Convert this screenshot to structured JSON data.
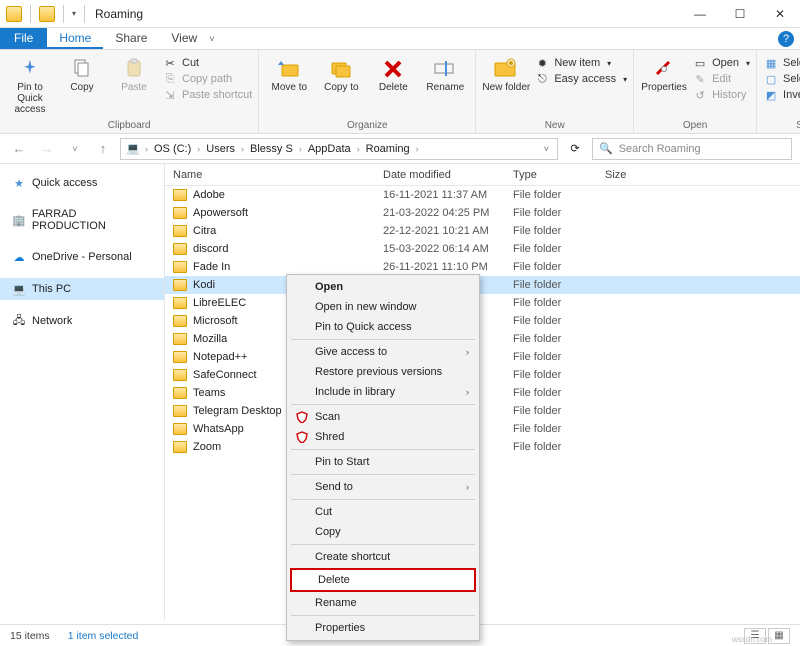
{
  "titlebar": {
    "title": "Roaming"
  },
  "tabs": {
    "file": "File",
    "home": "Home",
    "share": "Share",
    "view": "View"
  },
  "ribbon": {
    "clipboard": {
      "label": "Clipboard",
      "pin": "Pin to Quick access",
      "copy": "Copy",
      "paste": "Paste",
      "cut": "Cut",
      "copypath": "Copy path",
      "pasteshortcut": "Paste shortcut"
    },
    "organize": {
      "label": "Organize",
      "moveto": "Move to",
      "copyto": "Copy to",
      "delete": "Delete",
      "rename": "Rename"
    },
    "new": {
      "label": "New",
      "newfolder": "New folder",
      "newitem": "New item",
      "easyaccess": "Easy access"
    },
    "open": {
      "label": "Open",
      "properties": "Properties",
      "open": "Open",
      "edit": "Edit",
      "history": "History"
    },
    "select": {
      "label": "Select",
      "selectall": "Select all",
      "selectnone": "Select none",
      "invert": "Invert selection"
    }
  },
  "breadcrumb": [
    "OS (C:)",
    "Users",
    "Blessy S",
    "AppData",
    "Roaming"
  ],
  "search": {
    "placeholder": "Search Roaming"
  },
  "sidebar": {
    "quickaccess": "Quick access",
    "farrad": "FARRAD PRODUCTION",
    "onedrive": "OneDrive - Personal",
    "thispc": "This PC",
    "network": "Network"
  },
  "columns": {
    "name": "Name",
    "date": "Date modified",
    "type": "Type",
    "size": "Size"
  },
  "folders": [
    {
      "name": "Adobe",
      "date": "16-11-2021 11:37 AM",
      "type": "File folder"
    },
    {
      "name": "Apowersoft",
      "date": "21-03-2022 04:25 PM",
      "type": "File folder"
    },
    {
      "name": "Citra",
      "date": "22-12-2021 10:21 AM",
      "type": "File folder"
    },
    {
      "name": "discord",
      "date": "15-03-2022 06:14 AM",
      "type": "File folder"
    },
    {
      "name": "Fade In",
      "date": "26-11-2021 11:10 PM",
      "type": "File folder"
    },
    {
      "name": "Kodi",
      "date": "",
      "type": "File folder",
      "selected": true
    },
    {
      "name": "LibreELEC",
      "date": "",
      "type": "File folder"
    },
    {
      "name": "Microsoft",
      "date": "",
      "type": "File folder"
    },
    {
      "name": "Mozilla",
      "date": "",
      "type": "File folder"
    },
    {
      "name": "Notepad++",
      "date": "",
      "type": "File folder"
    },
    {
      "name": "SafeConnect",
      "date": "",
      "type": "File folder"
    },
    {
      "name": "Teams",
      "date": "",
      "type": "File folder"
    },
    {
      "name": "Telegram Desktop",
      "date": "",
      "type": "File folder"
    },
    {
      "name": "WhatsApp",
      "date": "",
      "type": "File folder"
    },
    {
      "name": "Zoom",
      "date": "",
      "type": "File folder"
    }
  ],
  "context_menu": [
    {
      "label": "Open",
      "bold": true
    },
    {
      "label": "Open in new window"
    },
    {
      "label": "Pin to Quick access"
    },
    {
      "sep": true
    },
    {
      "label": "Give access to",
      "submenu": true
    },
    {
      "label": "Restore previous versions"
    },
    {
      "label": "Include in library",
      "submenu": true
    },
    {
      "sep": true
    },
    {
      "label": "Scan",
      "icon": "shield-red"
    },
    {
      "label": "Shred",
      "icon": "shield-red"
    },
    {
      "sep": true
    },
    {
      "label": "Pin to Start"
    },
    {
      "sep": true
    },
    {
      "label": "Send to",
      "submenu": true
    },
    {
      "sep": true
    },
    {
      "label": "Cut"
    },
    {
      "label": "Copy"
    },
    {
      "sep": true
    },
    {
      "label": "Create shortcut"
    },
    {
      "label": "Delete",
      "highlight": true
    },
    {
      "label": "Rename"
    },
    {
      "sep": true
    },
    {
      "label": "Properties"
    }
  ],
  "status": {
    "items": "15 items",
    "selected": "1 item selected"
  },
  "watermark": "wsxdn.com"
}
